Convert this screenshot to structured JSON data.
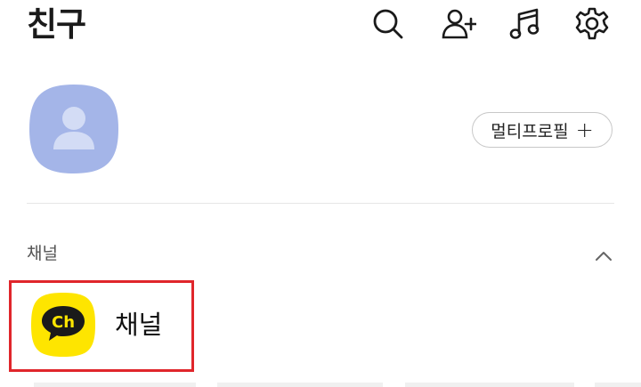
{
  "header": {
    "title": "친구",
    "icons": [
      "search-icon",
      "add-friend-icon",
      "music-icon",
      "settings-icon"
    ]
  },
  "profile": {
    "avatar_icon": "default-avatar-icon",
    "avatar_color": "#a4b5e8",
    "multi_profile_label": "멀티프로필",
    "multi_profile_plus": "+"
  },
  "section": {
    "label": "채널",
    "collapse_icon": "chevron-up-icon"
  },
  "channel": {
    "name": "채널",
    "icon_text": "Ch",
    "icon_color": "#fee500",
    "highlight_color": "#e0262b"
  }
}
